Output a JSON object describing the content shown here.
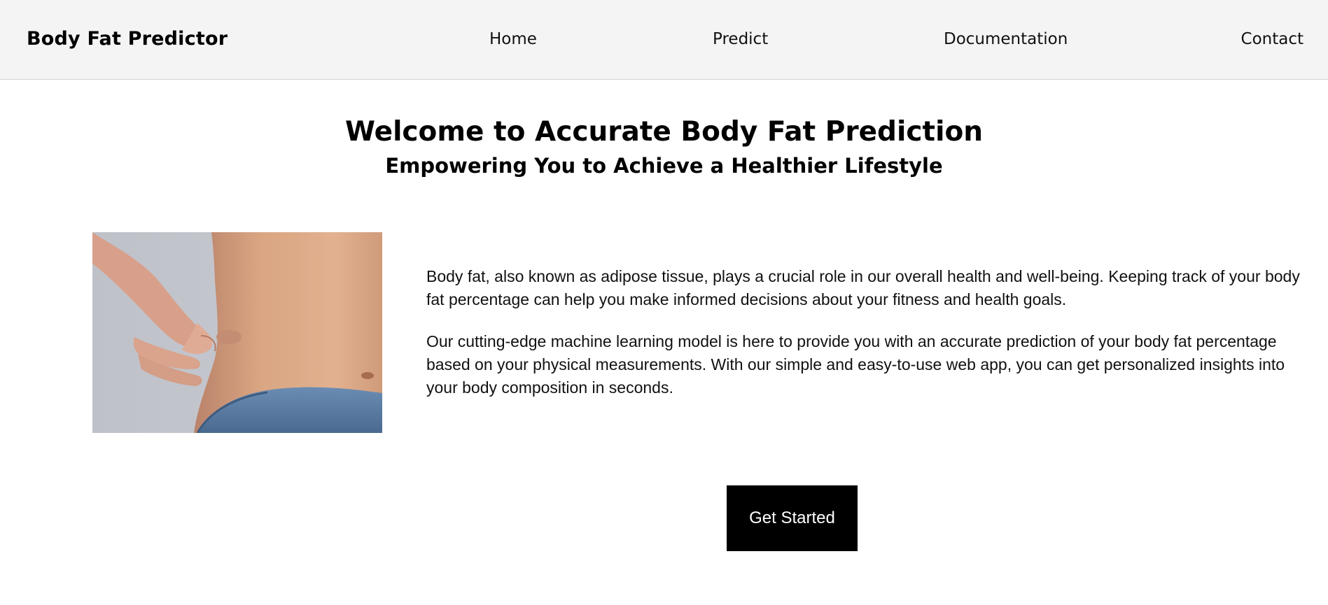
{
  "brand": {
    "name": "Body Fat Predictor"
  },
  "nav": {
    "items": [
      {
        "label": "Home"
      },
      {
        "label": "Predict"
      },
      {
        "label": "Documentation"
      },
      {
        "label": "Contact"
      }
    ]
  },
  "hero": {
    "title": "Welcome to Accurate Body Fat Prediction",
    "subtitle": "Empowering You to Achieve a Healthier Lifestyle"
  },
  "intro": {
    "paragraphs": [
      "Body fat, also known as adipose tissue, plays a crucial role in our overall health and well-being. Keeping track of your body fat percentage can help you make informed decisions about your fitness and health goals.",
      "Our cutting-edge machine learning model is here to provide you with an accurate prediction of your body fat percentage based on your physical measurements. With our simple and easy-to-use web app, you can get personalized insights into your body composition in seconds."
    ]
  },
  "cta": {
    "label": "Get Started"
  },
  "colors": {
    "header_bg": "#f4f4f4",
    "cta_bg": "#000000",
    "cta_text": "#ffffff",
    "image_bg": "#c2c4cb",
    "skin": "#d9a582",
    "jeans": "#5b7fa6"
  }
}
